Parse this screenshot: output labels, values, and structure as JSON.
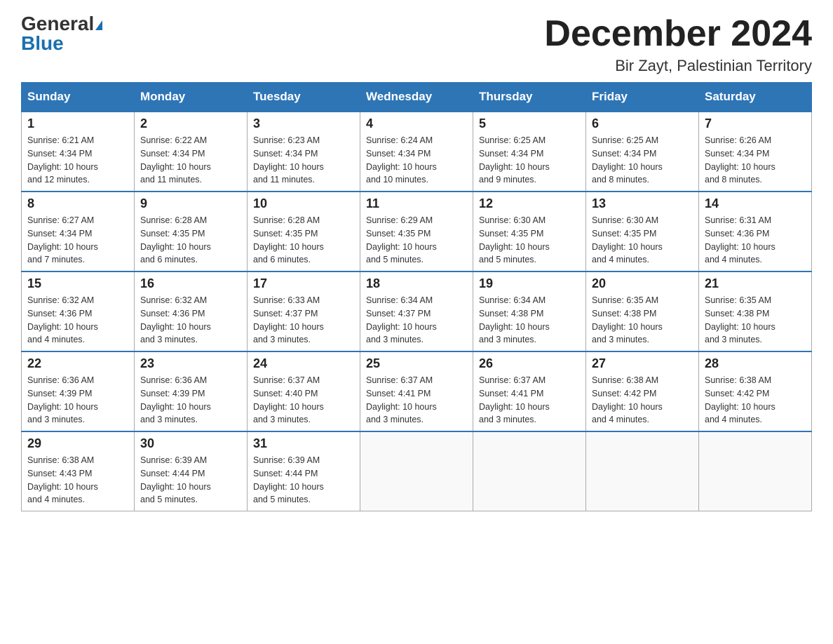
{
  "header": {
    "logo_general": "General",
    "logo_blue": "Blue",
    "month_title": "December 2024",
    "location": "Bir Zayt, Palestinian Territory"
  },
  "columns": [
    "Sunday",
    "Monday",
    "Tuesday",
    "Wednesday",
    "Thursday",
    "Friday",
    "Saturday"
  ],
  "weeks": [
    [
      {
        "day": "1",
        "sunrise": "6:21 AM",
        "sunset": "4:34 PM",
        "daylight": "10 hours and 12 minutes."
      },
      {
        "day": "2",
        "sunrise": "6:22 AM",
        "sunset": "4:34 PM",
        "daylight": "10 hours and 11 minutes."
      },
      {
        "day": "3",
        "sunrise": "6:23 AM",
        "sunset": "4:34 PM",
        "daylight": "10 hours and 11 minutes."
      },
      {
        "day": "4",
        "sunrise": "6:24 AM",
        "sunset": "4:34 PM",
        "daylight": "10 hours and 10 minutes."
      },
      {
        "day": "5",
        "sunrise": "6:25 AM",
        "sunset": "4:34 PM",
        "daylight": "10 hours and 9 minutes."
      },
      {
        "day": "6",
        "sunrise": "6:25 AM",
        "sunset": "4:34 PM",
        "daylight": "10 hours and 8 minutes."
      },
      {
        "day": "7",
        "sunrise": "6:26 AM",
        "sunset": "4:34 PM",
        "daylight": "10 hours and 8 minutes."
      }
    ],
    [
      {
        "day": "8",
        "sunrise": "6:27 AM",
        "sunset": "4:34 PM",
        "daylight": "10 hours and 7 minutes."
      },
      {
        "day": "9",
        "sunrise": "6:28 AM",
        "sunset": "4:35 PM",
        "daylight": "10 hours and 6 minutes."
      },
      {
        "day": "10",
        "sunrise": "6:28 AM",
        "sunset": "4:35 PM",
        "daylight": "10 hours and 6 minutes."
      },
      {
        "day": "11",
        "sunrise": "6:29 AM",
        "sunset": "4:35 PM",
        "daylight": "10 hours and 5 minutes."
      },
      {
        "day": "12",
        "sunrise": "6:30 AM",
        "sunset": "4:35 PM",
        "daylight": "10 hours and 5 minutes."
      },
      {
        "day": "13",
        "sunrise": "6:30 AM",
        "sunset": "4:35 PM",
        "daylight": "10 hours and 4 minutes."
      },
      {
        "day": "14",
        "sunrise": "6:31 AM",
        "sunset": "4:36 PM",
        "daylight": "10 hours and 4 minutes."
      }
    ],
    [
      {
        "day": "15",
        "sunrise": "6:32 AM",
        "sunset": "4:36 PM",
        "daylight": "10 hours and 4 minutes."
      },
      {
        "day": "16",
        "sunrise": "6:32 AM",
        "sunset": "4:36 PM",
        "daylight": "10 hours and 3 minutes."
      },
      {
        "day": "17",
        "sunrise": "6:33 AM",
        "sunset": "4:37 PM",
        "daylight": "10 hours and 3 minutes."
      },
      {
        "day": "18",
        "sunrise": "6:34 AM",
        "sunset": "4:37 PM",
        "daylight": "10 hours and 3 minutes."
      },
      {
        "day": "19",
        "sunrise": "6:34 AM",
        "sunset": "4:38 PM",
        "daylight": "10 hours and 3 minutes."
      },
      {
        "day": "20",
        "sunrise": "6:35 AM",
        "sunset": "4:38 PM",
        "daylight": "10 hours and 3 minutes."
      },
      {
        "day": "21",
        "sunrise": "6:35 AM",
        "sunset": "4:38 PM",
        "daylight": "10 hours and 3 minutes."
      }
    ],
    [
      {
        "day": "22",
        "sunrise": "6:36 AM",
        "sunset": "4:39 PM",
        "daylight": "10 hours and 3 minutes."
      },
      {
        "day": "23",
        "sunrise": "6:36 AM",
        "sunset": "4:39 PM",
        "daylight": "10 hours and 3 minutes."
      },
      {
        "day": "24",
        "sunrise": "6:37 AM",
        "sunset": "4:40 PM",
        "daylight": "10 hours and 3 minutes."
      },
      {
        "day": "25",
        "sunrise": "6:37 AM",
        "sunset": "4:41 PM",
        "daylight": "10 hours and 3 minutes."
      },
      {
        "day": "26",
        "sunrise": "6:37 AM",
        "sunset": "4:41 PM",
        "daylight": "10 hours and 3 minutes."
      },
      {
        "day": "27",
        "sunrise": "6:38 AM",
        "sunset": "4:42 PM",
        "daylight": "10 hours and 4 minutes."
      },
      {
        "day": "28",
        "sunrise": "6:38 AM",
        "sunset": "4:42 PM",
        "daylight": "10 hours and 4 minutes."
      }
    ],
    [
      {
        "day": "29",
        "sunrise": "6:38 AM",
        "sunset": "4:43 PM",
        "daylight": "10 hours and 4 minutes."
      },
      {
        "day": "30",
        "sunrise": "6:39 AM",
        "sunset": "4:44 PM",
        "daylight": "10 hours and 5 minutes."
      },
      {
        "day": "31",
        "sunrise": "6:39 AM",
        "sunset": "4:44 PM",
        "daylight": "10 hours and 5 minutes."
      },
      null,
      null,
      null,
      null
    ]
  ],
  "labels": {
    "sunrise": "Sunrise:",
    "sunset": "Sunset:",
    "daylight": "Daylight:"
  }
}
